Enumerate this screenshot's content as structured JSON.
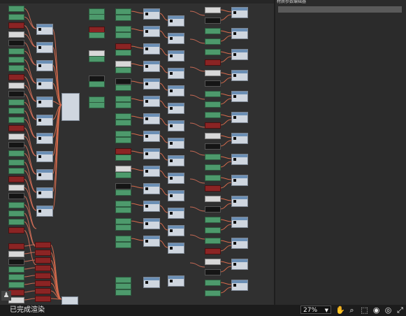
{
  "side_panel": {
    "title": "材质参数编辑器"
  },
  "status": {
    "text": "已完成渲染"
  },
  "zoom": {
    "value": "27%"
  },
  "icons": {
    "status": "render-status-icon",
    "pan": "hand-pan-icon",
    "zoom": "zoom-magnify-icon",
    "zoom_region": "zoom-region-icon",
    "frame_selected": "frame-selected-icon",
    "frame_all": "frame-all-icon",
    "fit": "fit-view-icon"
  }
}
